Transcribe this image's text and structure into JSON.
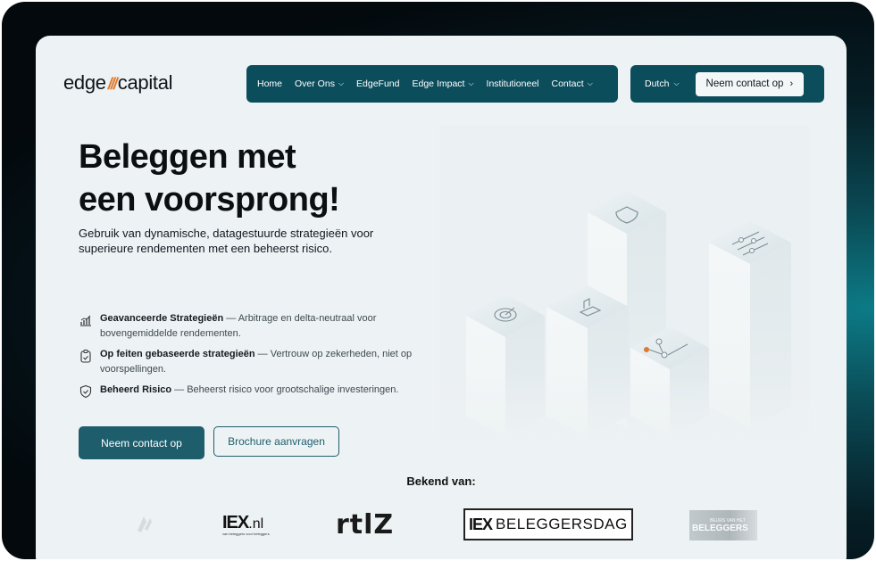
{
  "header": {
    "logo_left": "edge",
    "logo_slash": "///",
    "logo_right": "capital",
    "nav": [
      {
        "label": "Home",
        "dropdown": false
      },
      {
        "label": "Over Ons",
        "dropdown": true
      },
      {
        "label": "EdgeFund",
        "dropdown": false
      },
      {
        "label": "Edge Impact",
        "dropdown": true
      },
      {
        "label": "Institutioneel",
        "dropdown": false
      },
      {
        "label": "Contact",
        "dropdown": true
      }
    ],
    "language": "Dutch",
    "contact_button": "Neem contact op",
    "contact_arrow": "›"
  },
  "hero": {
    "title_line1": "Beleggen met",
    "title_line2": "een voorsprong!",
    "subtitle": "Gebruik van dynamische, datagestuurde strategieën voor superieure rendementen met een beheerst risico.",
    "features": [
      {
        "title": "Geavanceerde Strategieën",
        "text": " — Arbitrage en delta-neutraal voor bovengemiddelde rendementen.",
        "icon": "chart-icon"
      },
      {
        "title": "Op feiten gebaseerde strategieën",
        "text": " — Vertrouw op zekerheden, niet op voorspellingen.",
        "icon": "clipboard-icon"
      },
      {
        "title": "Beheerd Risico",
        "text": " — Beheerst risico voor grootschalige investeringen.",
        "icon": "shield-icon"
      }
    ],
    "primary_button": "Neem contact op",
    "secondary_button": "Brochure aanvragen"
  },
  "press": {
    "heading": "Bekend van:",
    "logos": [
      {
        "name": "iex-nl",
        "text_main": "IEX",
        "text_suffix": ".nl",
        "tagline": "van beleggers voor beleggers"
      },
      {
        "name": "rtlz",
        "text": "rtlZ"
      },
      {
        "name": "iex-beleggersdag",
        "text_left": "IEX",
        "text_right": "BELEGGERSDAG"
      },
      {
        "name": "beurs-van-het-jaar",
        "text_top": "BEURS VAN HET",
        "text": "BELEGGERS"
      }
    ]
  },
  "colors": {
    "nav_bg": "#0c4d5c",
    "primary": "#1e5e6c",
    "accent_orange": "#e07a2e",
    "page_bg": "#edf2f4"
  }
}
